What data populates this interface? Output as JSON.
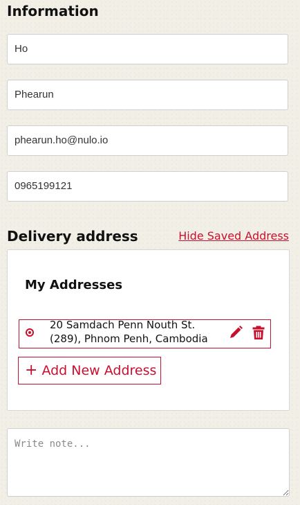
{
  "information": {
    "heading": "Information",
    "first_name": "Ho",
    "last_name": "Phearun",
    "email": "phearun.ho@nulo.io",
    "phone": "0965199121"
  },
  "delivery": {
    "heading": "Delivery address",
    "hide_link": "Hide Saved Address",
    "card_title": "My Addresses",
    "addresses": [
      {
        "line1": "20 Samdach Penn Nouth St.",
        "line2": "(289), Phnom Penh, Cambodia",
        "selected": true
      }
    ],
    "add_button": "Add New Address",
    "add_icon": "+"
  },
  "note": {
    "placeholder": "Write note..."
  },
  "colors": {
    "accent": "#c8102e",
    "background": "#f1efe6"
  }
}
